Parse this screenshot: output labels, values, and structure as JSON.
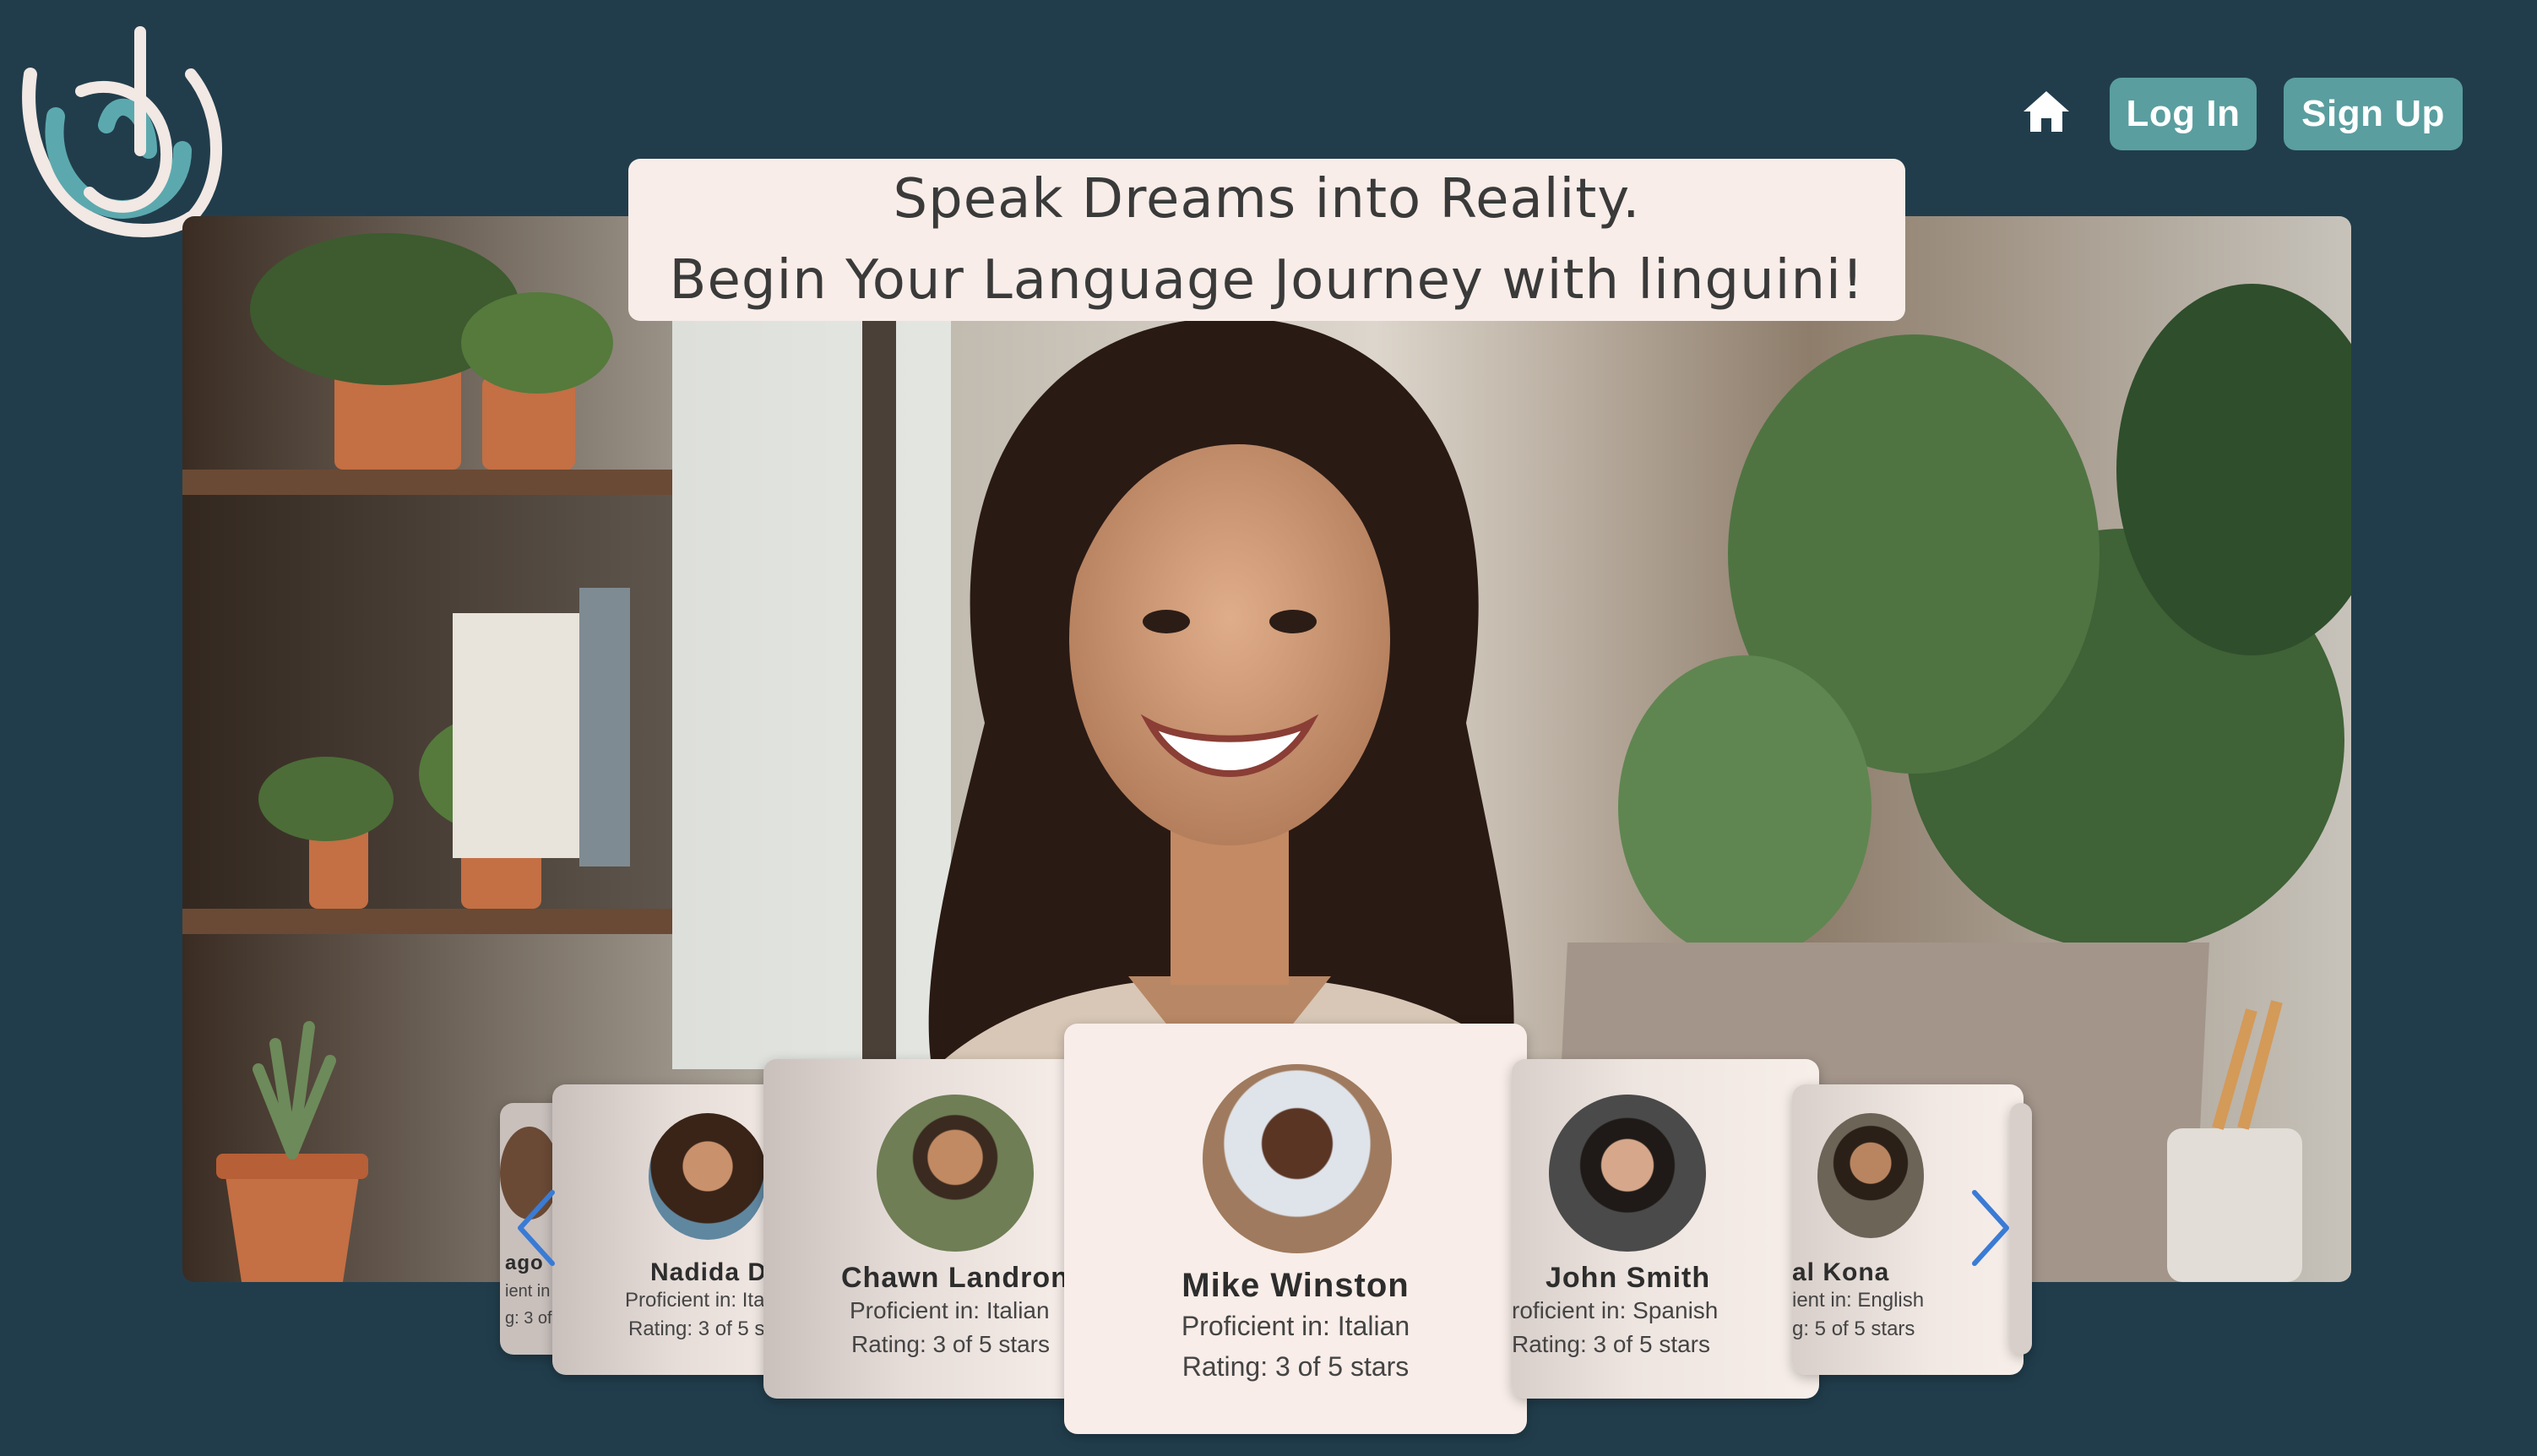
{
  "brand": {
    "logo_icon": "linguini-swirl-logo"
  },
  "nav": {
    "home_icon": "home-icon",
    "login_label": "Log In",
    "signup_label": "Sign Up"
  },
  "hero": {
    "headline_line1": "Speak Dreams into Reality.",
    "headline_line2": "Begin Your Language Journey with linguini!"
  },
  "carousel": {
    "prev_icon": "chevron-left-icon",
    "next_icon": "chevron-right-icon",
    "cards": [
      {
        "name": "ago",
        "proficient": "ient in",
        "rating": "g: 3 of"
      },
      {
        "name": "Nadida D",
        "proficient": "Proficient in: Ita",
        "rating": "Rating: 3 of 5 s"
      },
      {
        "name": "Chawn Landron",
        "proficient": "Proficient in: Italian",
        "rating": "Rating: 3 of 5 stars"
      },
      {
        "name": "Mike Winston",
        "proficient": "Proficient in: Italian",
        "rating": "Rating: 3 of 5 stars"
      },
      {
        "name": "John Smith",
        "proficient": "roficient in: Spanish",
        "rating": "Rating: 3 of 5 stars"
      },
      {
        "name": "al Kona",
        "proficient": "ient in: English",
        "rating": "g: 5 of 5 stars"
      }
    ]
  },
  "colors": {
    "background": "#213d4c",
    "button": "#5a9e9f",
    "card": "#f8ede8",
    "arrow": "#3a7bd5"
  }
}
